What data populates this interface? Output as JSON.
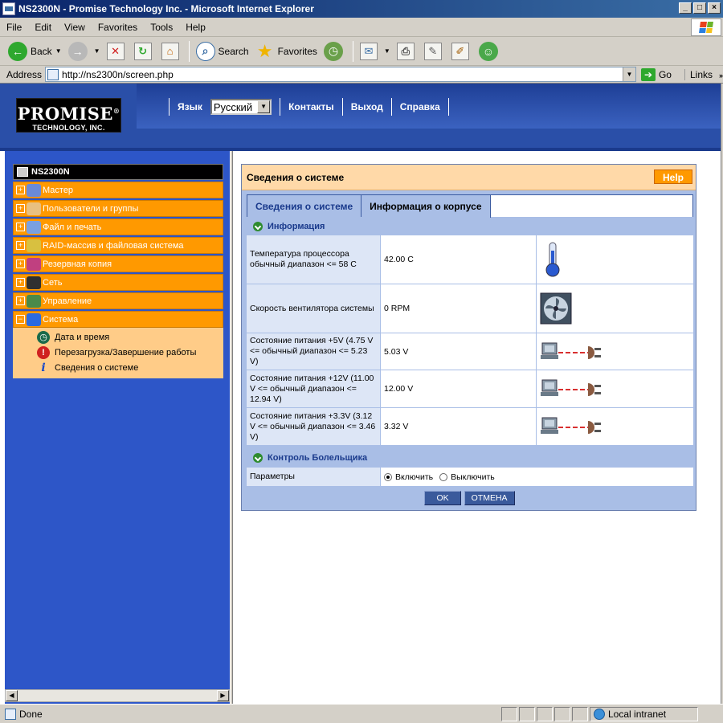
{
  "window": {
    "title": "NS2300N - Promise Technology Inc. - Microsoft Internet Explorer"
  },
  "menu": [
    "File",
    "Edit",
    "View",
    "Favorites",
    "Tools",
    "Help"
  ],
  "toolbar": {
    "back": "Back",
    "search": "Search",
    "favorites": "Favorites"
  },
  "address": {
    "label": "Address",
    "url": "http://ns2300n/screen.php",
    "go": "Go",
    "links": "Links"
  },
  "header": {
    "logo_line1": "PROMISE",
    "logo_line2": "TECHNOLOGY, INC.",
    "lang_label": "Язык",
    "lang_value": "Русский",
    "nav": [
      "Контакты",
      "Выход",
      "Справка"
    ]
  },
  "tree": {
    "root": "NS2300N",
    "nodes": [
      "Мастер",
      "Пользователи и группы",
      "Файл и печать",
      "RAID-массив и файловая система",
      "Резервная копия",
      "Сеть",
      "Управление",
      "Система"
    ],
    "leaves": [
      "Дата и время",
      "Перезагрузка/Завершение работы",
      "Сведения о системе"
    ]
  },
  "panel": {
    "title": "Сведения о системе",
    "help": "Help",
    "tabs": [
      "Сведения о системе",
      "Информация о корпусе"
    ],
    "section_info": "Информация",
    "rows": [
      {
        "label": "Температура процессора обычный диапазон <= 58 C",
        "value": "42.00 C"
      },
      {
        "label": "Скорость вентилятора системы",
        "value": "0 RPM"
      },
      {
        "label": "Состояние питания +5V (4.75 V <= обычный диапазон <= 5.23 V)",
        "value": "5.03 V"
      },
      {
        "label": "Состояние питания +12V (11.00 V <= обычный диапазон <= 12.94 V)",
        "value": "12.00 V"
      },
      {
        "label": "Состояние питания +3.3V (3.12 V <= обычный диапазон <= 3.46 V)",
        "value": "3.32 V"
      }
    ],
    "section_buzzer": "Контроль Болельщика",
    "param_label": "Параметры",
    "radio_on": "Включить",
    "radio_off": "Выключить",
    "ok": "OK",
    "cancel": "ОТМЕНА"
  },
  "status": {
    "text": "Done",
    "zone": "Local intranet"
  }
}
